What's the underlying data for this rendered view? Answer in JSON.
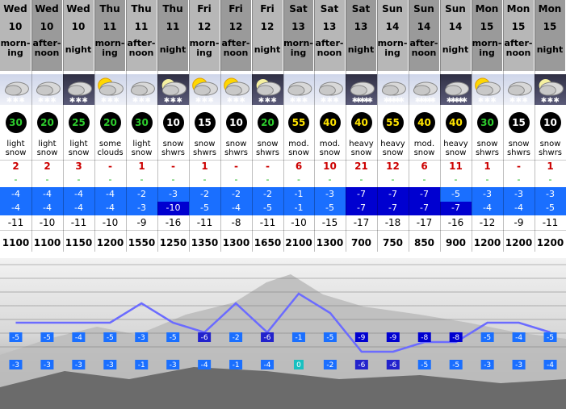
{
  "columns": [
    {
      "day": "Wed",
      "date": "10",
      "tod": [
        "morn-",
        "ing"
      ],
      "summary": [
        "light",
        "snow"
      ],
      "wind": "30",
      "wind_color": "#2dcc2d",
      "snow": "2",
      "rain": "-",
      "tmax": "-4",
      "tmin": "-4",
      "chill": "-11",
      "fl": "1100",
      "tmax_c": "#1a6fff",
      "tmin_c": "#1a6fff",
      "wind_dir": "se",
      "tone": "alt"
    },
    {
      "day": "Wed",
      "date": "10",
      "tod": [
        "after-",
        "noon"
      ],
      "summary": [
        "light",
        "snow"
      ],
      "wind": "20",
      "wind_color": "#2dcc2d",
      "snow": "2",
      "rain": "-",
      "tmax": "-4",
      "tmin": "-4",
      "chill": "-10",
      "fl": "1100",
      "tmax_c": "#1a6fff",
      "tmin_c": "#1a6fff",
      "wind_dir": "s",
      "tone": ""
    },
    {
      "day": "Wed",
      "date": "10",
      "tod": [
        "night"
      ],
      "summary": [
        "light",
        "snow"
      ],
      "wind": "25",
      "wind_color": "#2dcc2d",
      "snow": "3",
      "rain": "-",
      "tmax": "-4",
      "tmin": "-4",
      "chill": "-11",
      "fl": "1150",
      "tmax_c": "#1a6fff",
      "tmin_c": "#1a6fff",
      "wind_dir": "s",
      "tone": "alt"
    },
    {
      "day": "Thu",
      "date": "11",
      "tod": [
        "morn-",
        "ing"
      ],
      "summary": [
        "some",
        "clouds"
      ],
      "wind": "20",
      "wind_color": "#2dcc2d",
      "snow": "-",
      "rain": "-",
      "tmax": "-4",
      "tmin": "-4",
      "chill": "-10",
      "fl": "1200",
      "tmax_c": "#1a6fff",
      "tmin_c": "#1a6fff",
      "wind_dir": "e",
      "tone": ""
    },
    {
      "day": "Thu",
      "date": "11",
      "tod": [
        "after-",
        "noon"
      ],
      "summary": [
        "light",
        "snow"
      ],
      "wind": "30",
      "wind_color": "#2dcc2d",
      "snow": "1",
      "rain": "-",
      "tmax": "-2",
      "tmin": "-3",
      "chill": "-9",
      "fl": "1550",
      "tmax_c": "#1a6fff",
      "tmin_c": "#1a6fff",
      "wind_dir": "ne",
      "tone": "alt"
    },
    {
      "day": "Thu",
      "date": "11",
      "tod": [
        "night"
      ],
      "summary": [
        "snow",
        "shwrs"
      ],
      "wind": "10",
      "wind_color": "#ffffff",
      "snow": "-",
      "rain": "-",
      "tmax": "-3",
      "tmin": "-10",
      "chill": "-16",
      "fl": "1250",
      "tmax_c": "#1a6fff",
      "tmin_c": "#0000d0",
      "wind_dir": "e",
      "tone": ""
    },
    {
      "day": "Fri",
      "date": "12",
      "tod": [
        "morn-",
        "ing"
      ],
      "summary": [
        "snow",
        "shwrs"
      ],
      "wind": "15",
      "wind_color": "#ffffff",
      "snow": "1",
      "rain": "-",
      "tmax": "-2",
      "tmin": "-5",
      "chill": "-11",
      "fl": "1350",
      "tmax_c": "#1a6fff",
      "tmin_c": "#1a6fff",
      "wind_dir": "se",
      "tone": "alt"
    },
    {
      "day": "Fri",
      "date": "12",
      "tod": [
        "after-",
        "noon"
      ],
      "summary": [
        "snow",
        "shwrs"
      ],
      "wind": "10",
      "wind_color": "#ffffff",
      "snow": "-",
      "rain": "-",
      "tmax": "-2",
      "tmin": "-4",
      "chill": "-8",
      "fl": "1300",
      "tmax_c": "#1a6fff",
      "tmin_c": "#1a6fff",
      "wind_dir": "s",
      "tone": ""
    },
    {
      "day": "Fri",
      "date": "12",
      "tod": [
        "night"
      ],
      "summary": [
        "snow",
        "shwrs"
      ],
      "wind": "20",
      "wind_color": "#2dcc2d",
      "snow": "-",
      "rain": "-",
      "tmax": "-2",
      "tmin": "-5",
      "chill": "-11",
      "fl": "1650",
      "tmax_c": "#1a6fff",
      "tmin_c": "#1a6fff",
      "wind_dir": "e",
      "tone": "alt"
    },
    {
      "day": "Sat",
      "date": "13",
      "tod": [
        "morn-",
        "ing"
      ],
      "summary": [
        "mod.",
        "snow"
      ],
      "wind": "55",
      "wind_color": "#ffe400",
      "snow": "6",
      "rain": "-",
      "tmax": "-1",
      "tmin": "-1",
      "chill": "-10",
      "fl": "2100",
      "tmax_c": "#1a6fff",
      "tmin_c": "#1a6fff",
      "wind_dir": "se",
      "tone": ""
    },
    {
      "day": "Sat",
      "date": "13",
      "tod": [
        "after-",
        "noon"
      ],
      "summary": [
        "mod.",
        "snow"
      ],
      "wind": "40",
      "wind_color": "#ffe400",
      "snow": "10",
      "rain": "-",
      "tmax": "-3",
      "tmin": "-5",
      "chill": "-15",
      "fl": "1300",
      "tmax_c": "#1a6fff",
      "tmin_c": "#1a6fff",
      "wind_dir": "se",
      "tone": "alt"
    },
    {
      "day": "Sat",
      "date": "13",
      "tod": [
        "night"
      ],
      "summary": [
        "heavy",
        "snow"
      ],
      "wind": "40",
      "wind_color": "#ffe400",
      "snow": "21",
      "rain": "-",
      "tmax": "-7",
      "tmin": "-7",
      "chill": "-17",
      "fl": "700",
      "tmax_c": "#0000d0",
      "tmin_c": "#0000d0",
      "wind_dir": "se",
      "tone": ""
    },
    {
      "day": "Sun",
      "date": "14",
      "tod": [
        "morn-",
        "ing"
      ],
      "summary": [
        "heavy",
        "snow"
      ],
      "wind": "55",
      "wind_color": "#ffe400",
      "snow": "12",
      "rain": "-",
      "tmax": "-7",
      "tmin": "-7",
      "chill": "-18",
      "fl": "750",
      "tmax_c": "#0000d0",
      "tmin_c": "#0000d0",
      "wind_dir": "s",
      "tone": "alt"
    },
    {
      "day": "Sun",
      "date": "14",
      "tod": [
        "after-",
        "noon"
      ],
      "summary": [
        "mod.",
        "snow"
      ],
      "wind": "40",
      "wind_color": "#ffe400",
      "snow": "6",
      "rain": "-",
      "tmax": "-7",
      "tmin": "-7",
      "chill": "-17",
      "fl": "850",
      "tmax_c": "#0000d0",
      "tmin_c": "#0000d0",
      "wind_dir": "s",
      "tone": ""
    },
    {
      "day": "Sun",
      "date": "14",
      "tod": [
        "night"
      ],
      "summary": [
        "heavy",
        "snow"
      ],
      "wind": "40",
      "wind_color": "#ffe400",
      "snow": "11",
      "rain": "-",
      "tmax": "-5",
      "tmin": "-7",
      "chill": "-16",
      "fl": "900",
      "tmax_c": "#1a6fff",
      "tmin_c": "#0000d0",
      "wind_dir": "ne",
      "tone": "alt"
    },
    {
      "day": "Mon",
      "date": "15",
      "tod": [
        "morn-",
        "ing"
      ],
      "summary": [
        "snow",
        "shwrs"
      ],
      "wind": "30",
      "wind_color": "#2dcc2d",
      "snow": "1",
      "rain": "-",
      "tmax": "-3",
      "tmin": "-4",
      "chill": "-12",
      "fl": "1200",
      "tmax_c": "#1a6fff",
      "tmin_c": "#1a6fff",
      "wind_dir": "s",
      "tone": ""
    },
    {
      "day": "Mon",
      "date": "15",
      "tod": [
        "after-",
        "noon"
      ],
      "summary": [
        "snow",
        "shwrs"
      ],
      "wind": "15",
      "wind_color": "#ffffff",
      "snow": "-",
      "rain": "-",
      "tmax": "-3",
      "tmin": "-4",
      "chill": "-9",
      "fl": "1200",
      "tmax_c": "#1a6fff",
      "tmin_c": "#1a6fff",
      "wind_dir": "se",
      "tone": "alt"
    },
    {
      "day": "Mon",
      "date": "15",
      "tod": [
        "night"
      ],
      "summary": [
        "snow",
        "shwrs"
      ],
      "wind": "10",
      "wind_color": "#ffffff",
      "snow": "1",
      "rain": "-",
      "tmax": "-3",
      "tmin": "-5",
      "chill": "-11",
      "fl": "1200",
      "tmax_c": "#1a6fff",
      "tmin_c": "#1a6fff",
      "wind_dir": "se",
      "tone": ""
    }
  ],
  "icon_names": [
    "snow-cloud-icon",
    "snow-cloud-icon",
    "night-snow-cloud-icon",
    "sun-cloud-icon",
    "snow-cloud-icon",
    "moon-snow-icon",
    "sun-snow-icon",
    "sun-snow-icon",
    "moon-snow-icon",
    "snow-cloud-icon",
    "snow-cloud-icon",
    "heavy-snow-icon",
    "heavy-snow-icon",
    "heavy-snow-icon",
    "heavy-snow-icon",
    "sun-snow-icon",
    "snow-cloud-icon",
    "moon-snow-icon"
  ],
  "chart_data": {
    "type": "line",
    "series": [
      {
        "values": [
          -5,
          -5,
          -4,
          -5,
          -3,
          -5,
          -6,
          -2,
          -6,
          -1,
          -5,
          -9,
          -9,
          -8,
          -8,
          -5,
          -4,
          -5
        ]
      },
      {
        "values": [
          -3,
          -3,
          -3,
          -3,
          -1,
          -3,
          -4,
          -1,
          -4,
          0,
          -2,
          -6,
          -6,
          -5,
          -5,
          -3,
          -3,
          -4
        ]
      }
    ]
  }
}
